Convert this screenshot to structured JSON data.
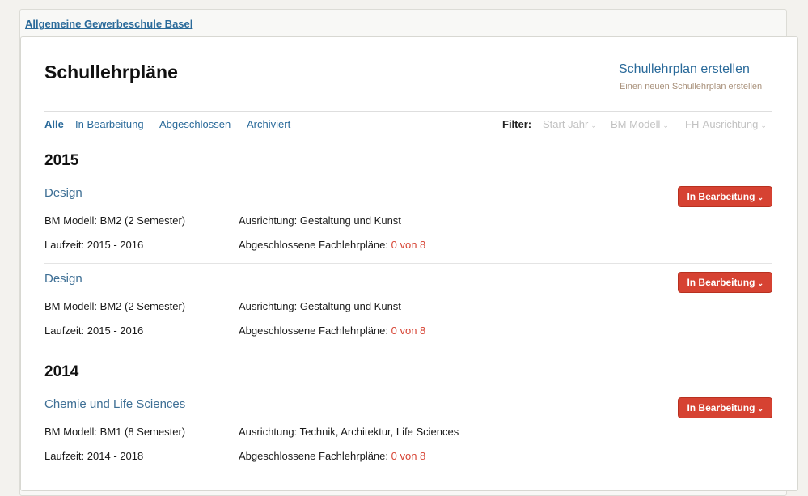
{
  "school": "Allgemeine Gewerbeschule Basel",
  "page_title": "Schullehrpläne",
  "create": {
    "link": "Schullehrplan erstellen",
    "subtitle": "Einen neuen Schullehrplan erstellen"
  },
  "tabs": [
    {
      "label": "Alle",
      "active": true
    },
    {
      "label": "In Bearbeitung",
      "active": false
    },
    {
      "label": "Abgeschlossen",
      "active": false
    },
    {
      "label": "Archiviert",
      "active": false
    }
  ],
  "filter": {
    "label": "Filter:",
    "options": [
      "Start Jahr",
      "BM Modell",
      "FH-Ausrichtung"
    ],
    "chevron": "⌄"
  },
  "groups": [
    {
      "year": "2015",
      "plans": [
        {
          "title": "Design",
          "status": "In Bearbeitung",
          "bm_label": "BM Modell:",
          "bm_value": "BM2 (2 Semester)",
          "dir_label": "Ausrichtung:",
          "dir_value": "Gestaltung und Kunst",
          "runtime_label": "Laufzeit:",
          "runtime_value": "2015 - 2016",
          "done_label": "Abgeschlossene Fachlehrpläne:",
          "done_value": "0 von 8"
        },
        {
          "title": "Design",
          "status": "In Bearbeitung",
          "bm_label": "BM Modell:",
          "bm_value": "BM2 (2 Semester)",
          "dir_label": "Ausrichtung:",
          "dir_value": "Gestaltung und Kunst",
          "runtime_label": "Laufzeit:",
          "runtime_value": "2015 - 2016",
          "done_label": "Abgeschlossene Fachlehrpläne:",
          "done_value": "0 von 8"
        }
      ]
    },
    {
      "year": "2014",
      "plans": [
        {
          "title": "Chemie und Life Sciences",
          "status": "In Bearbeitung",
          "bm_label": "BM Modell:",
          "bm_value": "BM1 (8 Semester)",
          "dir_label": "Ausrichtung:",
          "dir_value": "Technik, Architektur, Life Sciences",
          "runtime_label": "Laufzeit:",
          "runtime_value": "2014 - 2018",
          "done_label": "Abgeschlossene Fachlehrpläne:",
          "done_value": "0 von 8"
        }
      ]
    }
  ],
  "colors": {
    "accent_link": "#2a6a9a",
    "status_red": "#d64232",
    "plan_title": "#3e6f95"
  }
}
